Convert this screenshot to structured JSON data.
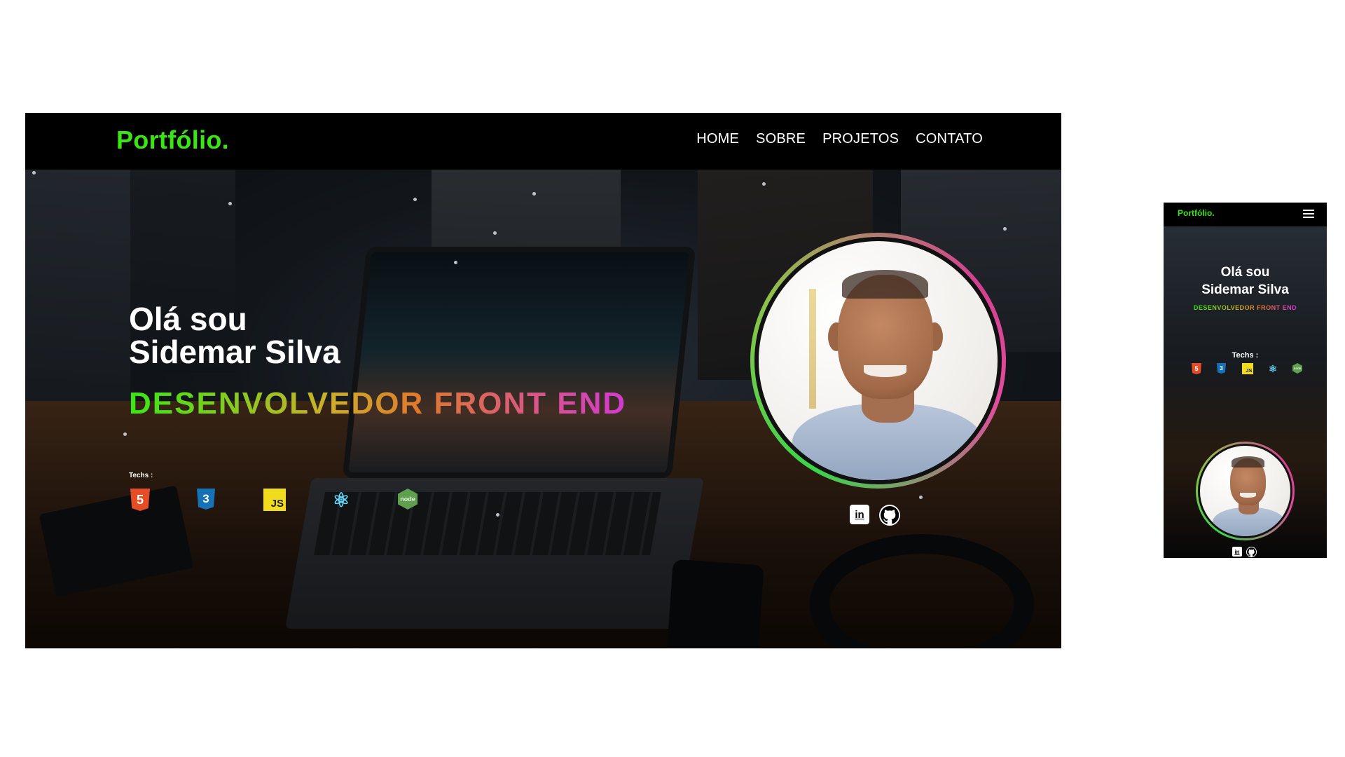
{
  "desktop": {
    "logo": "Portfólio.",
    "nav": [
      "HOME",
      "SOBRE",
      "PROJETOS",
      "CONTATO"
    ],
    "greeting_line1": "Olá sou",
    "greeting_line2": "Sidemar Silva",
    "role": "DESENVOLVEDOR FRONT END",
    "techs_label": "Techs :",
    "techs": [
      {
        "name": "HTML5",
        "icon": "html5-icon",
        "glyph": "5"
      },
      {
        "name": "CSS3",
        "icon": "css3-icon",
        "glyph": "3"
      },
      {
        "name": "JavaScript",
        "icon": "javascript-icon",
        "glyph": "JS"
      },
      {
        "name": "React",
        "icon": "react-icon",
        "glyph": "⚛"
      },
      {
        "name": "Node.js",
        "icon": "nodejs-icon",
        "glyph": "node"
      }
    ],
    "social": [
      {
        "name": "LinkedIn",
        "icon": "linkedin-icon",
        "glyph": "in"
      },
      {
        "name": "GitHub",
        "icon": "github-icon"
      }
    ]
  },
  "mobile": {
    "logo": "Portfólio.",
    "greeting_line1": "Olá sou",
    "greeting_line2": "Sidemar Silva",
    "role": "DESENVOLVEDOR FRONT END",
    "techs_label": "Techs :"
  },
  "colors": {
    "accent_green": "#39e614",
    "nav_bg": "#000000",
    "gradient_pink": "#d23ad0"
  }
}
